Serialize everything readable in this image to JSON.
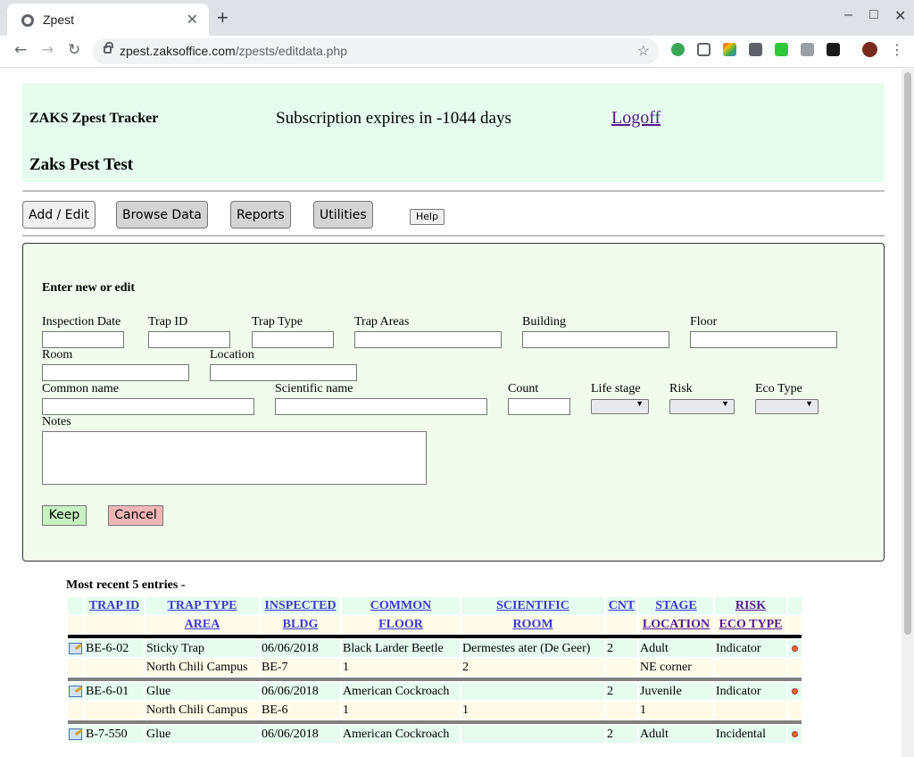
{
  "browser": {
    "tab_title": "Zpest",
    "url_host": "zpest.zaksoffice.com",
    "url_path": "/zpests/editdata.php"
  },
  "header": {
    "app_name": "ZAKS Zpest Tracker",
    "subscription": "Subscription expires in -1044 days",
    "logoff": "Logoff",
    "company": "Zaks Pest Test"
  },
  "nav": {
    "add_edit": "Add / Edit",
    "browse": "Browse Data",
    "reports": "Reports",
    "utilities": "Utilities",
    "help": "Help"
  },
  "form": {
    "heading": "Enter new or edit",
    "labels": {
      "inspection_date": "Inspection Date",
      "trap_id": "Trap ID",
      "trap_type": "Trap Type",
      "trap_areas": "Trap Areas",
      "building": "Building",
      "floor": "Floor",
      "room": "Room",
      "location": "Location",
      "common_name": "Common name",
      "scientific_name": "Scientific name",
      "count": "Count",
      "life_stage": "Life stage",
      "risk": "Risk",
      "eco_type": "Eco Type",
      "notes": "Notes"
    },
    "keep": "Keep",
    "cancel": "Cancel"
  },
  "table": {
    "title": "Most recent 5 entries -",
    "headers_row1": [
      "TRAP ID",
      "TRAP TYPE",
      "INSPECTED",
      "COMMON",
      "SCIENTIFIC",
      "CNT",
      "STAGE",
      "RISK"
    ],
    "headers_row2": [
      "AREA",
      "BLDG",
      "FLOOR",
      "ROOM",
      "LOCATION",
      "ECO TYPE"
    ],
    "entries": [
      {
        "trap_id": "BE-6-02",
        "trap_type": "Sticky Trap",
        "inspected": "06/06/2018",
        "common": "Black Larder Beetle",
        "scientific": "Dermestes ater (De Geer)",
        "cnt": "2",
        "stage": "Adult",
        "risk": "Indicator",
        "area": "North Chili Campus",
        "bldg": "BE-7",
        "floor": "1",
        "room": "2",
        "location": "NE corner",
        "eco_type": ""
      },
      {
        "trap_id": "BE-6-01",
        "trap_type": "Glue",
        "inspected": "06/06/2018",
        "common": "American Cockroach",
        "scientific": "",
        "cnt": "2",
        "stage": "Juvenile",
        "risk": "Indicator",
        "area": "North Chili Campus",
        "bldg": "BE-6",
        "floor": "1",
        "room": "1",
        "location": "1",
        "eco_type": ""
      },
      {
        "trap_id": "B-7-550",
        "trap_type": "Glue",
        "inspected": "06/06/2018",
        "common": "American Cockroach",
        "scientific": "",
        "cnt": "2",
        "stage": "Adult",
        "risk": "Incidental"
      }
    ]
  }
}
